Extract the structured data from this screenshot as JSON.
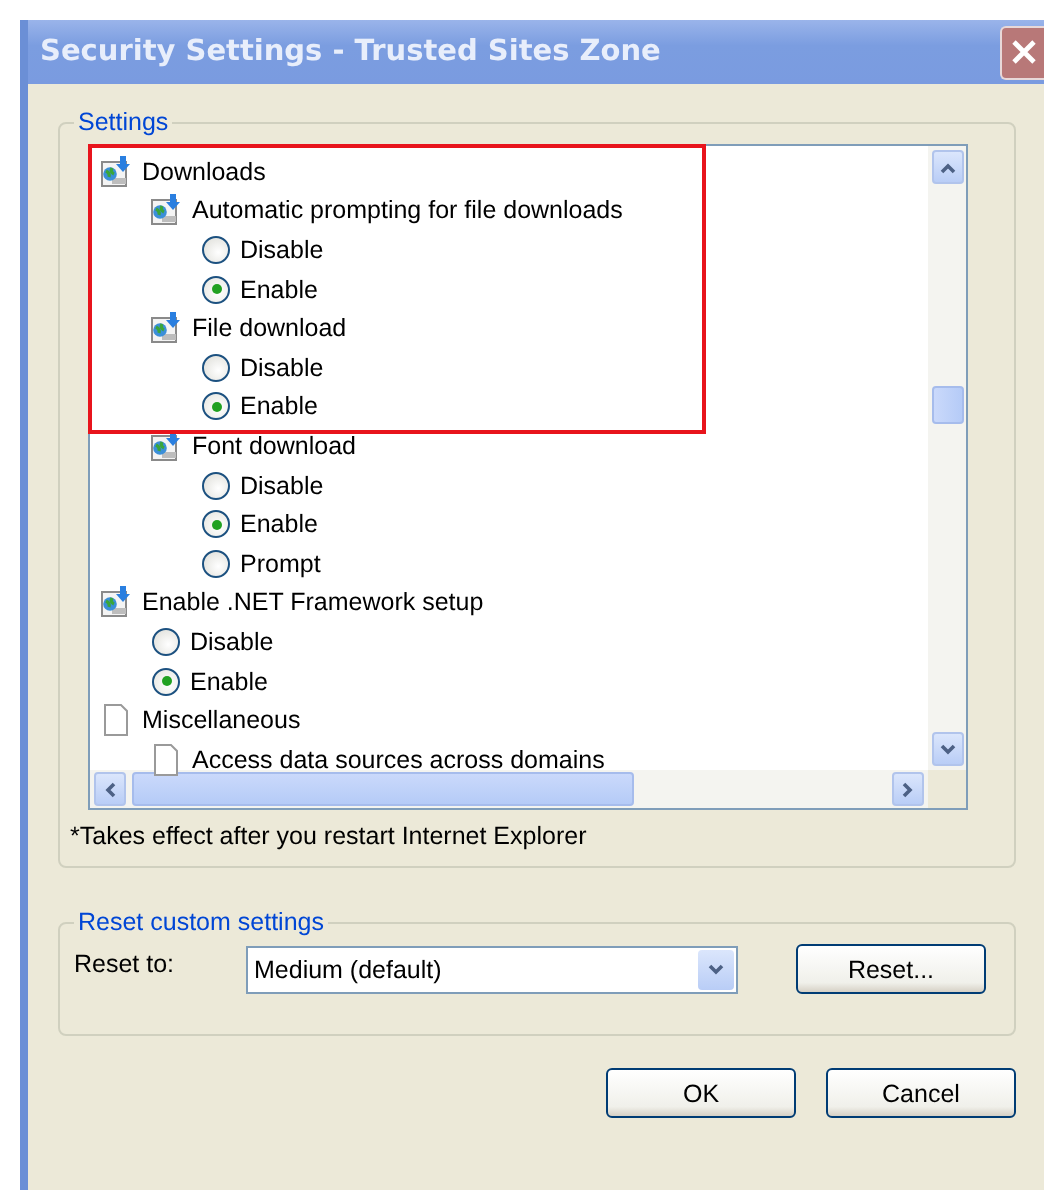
{
  "window": {
    "title": "Security Settings - Trusted Sites Zone"
  },
  "settings": {
    "legend": "Settings",
    "tree": [
      {
        "kind": "globe",
        "label": "Downloads",
        "children": [
          {
            "kind": "globe",
            "label": "Automatic prompting for file downloads",
            "children": [
              {
                "kind": "radio",
                "label": "Disable",
                "selected": false
              },
              {
                "kind": "radio",
                "label": "Enable",
                "selected": true
              }
            ]
          },
          {
            "kind": "globe",
            "label": "File download",
            "children": [
              {
                "kind": "radio",
                "label": "Disable",
                "selected": false
              },
              {
                "kind": "radio",
                "label": "Enable",
                "selected": true
              }
            ]
          },
          {
            "kind": "globe",
            "label": "Font download",
            "children": [
              {
                "kind": "radio",
                "label": "Disable",
                "selected": false
              },
              {
                "kind": "radio",
                "label": "Enable",
                "selected": true
              },
              {
                "kind": "radio",
                "label": "Prompt",
                "selected": false
              }
            ]
          }
        ]
      },
      {
        "kind": "globe",
        "label": "Enable .NET Framework setup",
        "children": [
          {
            "kind": "radio",
            "label": "Disable",
            "selected": false
          },
          {
            "kind": "radio",
            "label": "Enable",
            "selected": true
          }
        ]
      },
      {
        "kind": "page",
        "label": "Miscellaneous",
        "children": [
          {
            "kind": "page",
            "label": "Access data sources across domains"
          }
        ]
      }
    ],
    "note": "*Takes effect after you restart Internet Explorer"
  },
  "reset": {
    "legend": "Reset custom settings",
    "label": "Reset to:",
    "value": "Medium (default)",
    "button": "Reset..."
  },
  "buttons": [
    "OK",
    "Cancel"
  ]
}
